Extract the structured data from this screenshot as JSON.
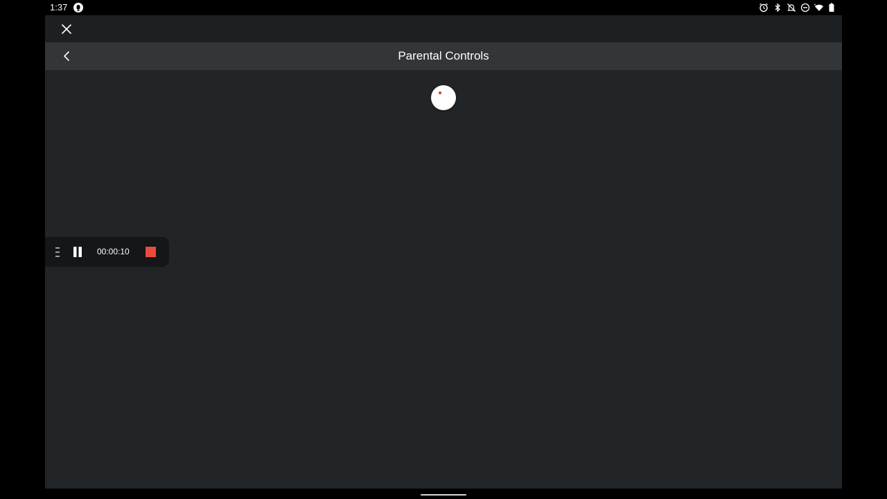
{
  "status_bar": {
    "time": "1:37",
    "icons": [
      "notification-icon",
      "alarm-icon",
      "bluetooth-icon",
      "mute-icon",
      "do-not-disturb-icon",
      "wifi-icon",
      "battery-icon"
    ]
  },
  "toolbar": {
    "close_icon": "close-icon"
  },
  "header": {
    "back_icon": "chevron-left-icon",
    "title": "Parental Controls"
  },
  "content": {
    "loading_indicator": "loading-spinner"
  },
  "recorder": {
    "elapsed": "00:00:10",
    "stop_color": "#ea4b3c"
  },
  "colors": {
    "app_background": "#222527",
    "header_background": "#333638",
    "text": "#ffffff"
  }
}
